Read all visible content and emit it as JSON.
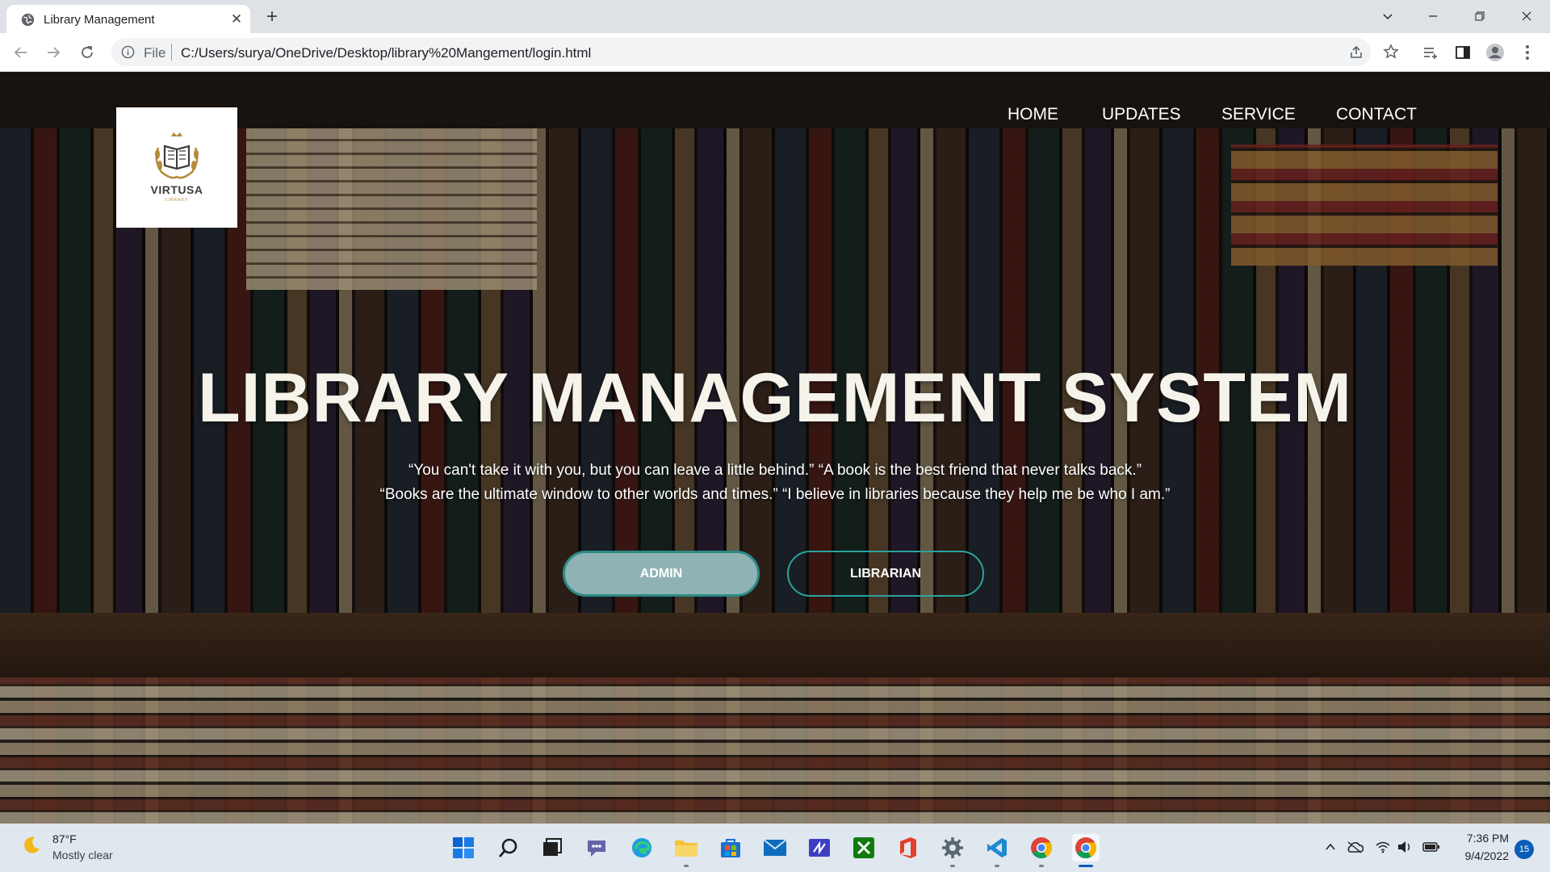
{
  "browser": {
    "tab_title": "Library Management",
    "tab_close": "✕",
    "new_tab": "+",
    "scheme_label": "File",
    "url": "C:/Users/surya/OneDrive/Desktop/library%20Mangement/login.html"
  },
  "page": {
    "logo": {
      "name": "VIRTUSA",
      "subtitle": "LIBRARY"
    },
    "nav": [
      "HOME",
      "UPDATES",
      "SERVICE",
      "CONTACT"
    ],
    "title": "LIBRARY MANAGEMENT SYSTEM",
    "quotes": [
      "“You can't take it with you, but you can leave a little behind.” “A book is the best friend that never talks back.”",
      "“Books are the ultimate window to other worlds and times.” “I believe in libraries because they help me be who I am.”"
    ],
    "buttons": {
      "admin": "ADMIN",
      "librarian": "LIBRARIAN"
    },
    "colors": {
      "admin_fill": "#8fb3b4",
      "button_border": "#2aa39e"
    }
  },
  "taskbar": {
    "weather_temp": "87°F",
    "weather_desc": "Mostly clear",
    "time": "7:36 PM",
    "date": "9/4/2022",
    "notification_count": "15",
    "apps": [
      "windows-start",
      "search",
      "task-view",
      "teams-chat",
      "edge",
      "file-explorer",
      "microsoft-store",
      "mail",
      "visual-studio",
      "xbox",
      "office",
      "settings",
      "vscode",
      "chrome",
      "chrome-active"
    ]
  }
}
